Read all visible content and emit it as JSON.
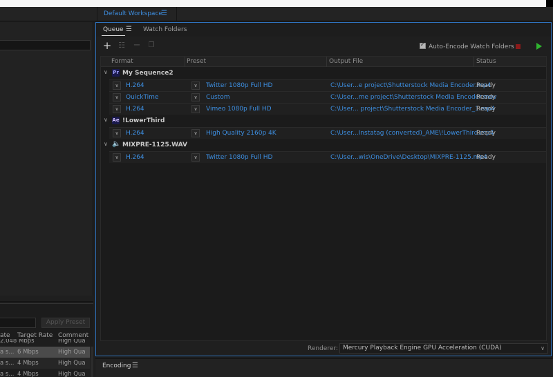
{
  "workspace": {
    "tab_label": "Default Workspace"
  },
  "queue": {
    "tabs": [
      {
        "label": "Queue"
      },
      {
        "label": "Watch Folders"
      }
    ],
    "auto_encode_label": "Auto-Encode Watch Folders",
    "columns": {
      "format": "Format",
      "preset": "Preset",
      "output": "Output File",
      "status": "Status"
    },
    "groups": [
      {
        "name": "My Sequence2",
        "badge": "Pr",
        "items": [
          {
            "format": "H.264",
            "preset": "Twitter 1080p Full HD",
            "output": "C:\\User...e project\\Shutterstock Media Encoder.mp4",
            "status": "Ready"
          },
          {
            "format": "QuickTime",
            "preset": "Custom",
            "output": "C:\\User...me project\\Shutterstock Media Encoder.mov",
            "status": "Ready"
          },
          {
            "format": "H.264",
            "preset": "Vimeo 1080p Full HD",
            "output": "C:\\User... project\\Shutterstock Media Encoder_1.mp4",
            "status": "Ready"
          }
        ]
      },
      {
        "name": "!LowerThird",
        "badge": "Ae",
        "items": [
          {
            "format": "H.264",
            "preset": "High Quality 2160p 4K",
            "output": "C:\\User...Instatag (converted)_AME\\!LowerThird.mp4",
            "status": "Ready"
          }
        ]
      },
      {
        "name": "MIXPRE-1125.WAV",
        "badge": "",
        "items": [
          {
            "format": "H.264",
            "preset": "Twitter 1080p Full HD",
            "output": "C:\\User...wis\\OneDrive\\Desktop\\MIXPRE-1125.mp4",
            "status": "Ready"
          }
        ]
      }
    ],
    "renderer_label": "Renderer:",
    "renderer_value": "Mercury Playback Engine GPU Acceleration (CUDA)"
  },
  "left_panel": {
    "apply_preset": "Apply Preset",
    "columns": {
      "rate": "ate",
      "target": "Target Rate",
      "comment": "Comment"
    },
    "rows": [
      {
        "rate": "2.048 Mbps",
        "target": "",
        "comment": "High Qua"
      },
      {
        "rate": "a s...",
        "target": "6 Mbps",
        "comment": "High Qua"
      },
      {
        "rate": "a s...",
        "target": "4 Mbps",
        "comment": "High Qua"
      },
      {
        "rate": "a s...",
        "target": "4 Mbps",
        "comment": "High Qua"
      }
    ]
  },
  "encoding": {
    "tab_label": "Encoding"
  }
}
